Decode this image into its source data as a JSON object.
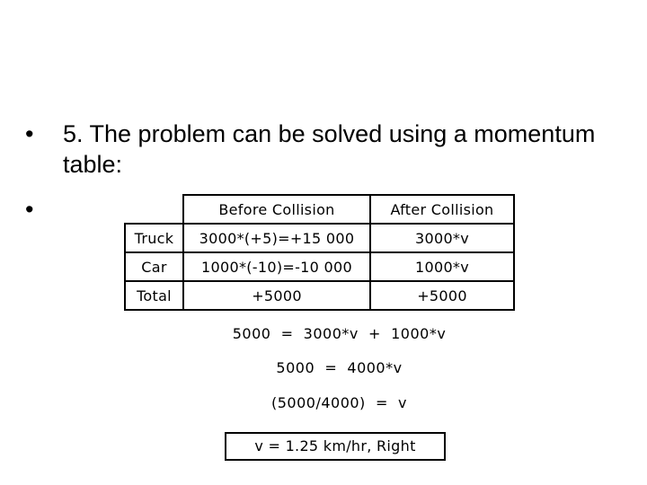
{
  "slide": {
    "bullets": [
      {
        "marker": "•",
        "text": "5. The problem can be solved using a momentum table:"
      },
      {
        "marker": "•",
        "text": ""
      }
    ],
    "table": {
      "headers": [
        "",
        "Before Collision",
        "After Collision"
      ],
      "rows": [
        [
          "Truck",
          "3000*(+5)=+15 000",
          "3000*v"
        ],
        [
          "Car",
          "1000*(-10)=-10 000",
          "1000*v"
        ],
        [
          "Total",
          "+5000",
          "+5000"
        ]
      ]
    },
    "equations": [
      "5000  =  3000*v  +  1000*v",
      "5000  =  4000*v",
      "(5000/4000)  =  v"
    ],
    "answer": "v = 1.25 km/hr, Right"
  }
}
